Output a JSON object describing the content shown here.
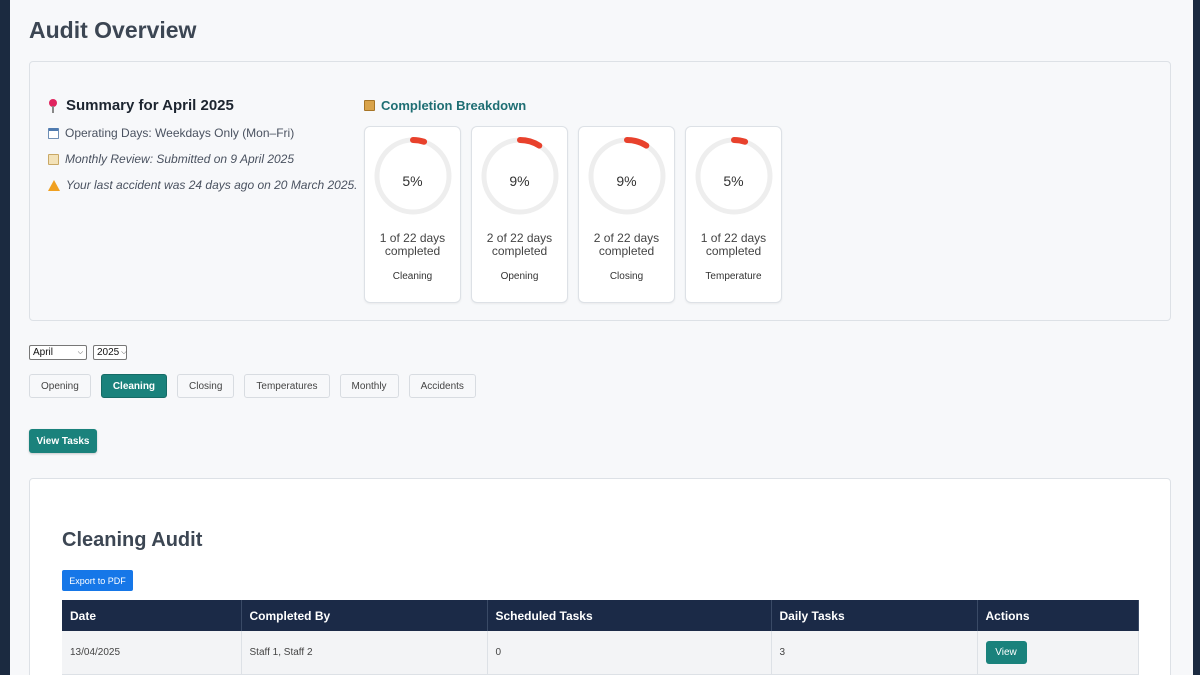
{
  "page": {
    "title": "Audit Overview"
  },
  "summary": {
    "heading": "Summary for April 2025",
    "operating_days": "Operating Days: Weekdays Only (Mon–Fri)",
    "monthly_review": "Monthly Review: Submitted on 9 April 2025",
    "last_accident": "Your last accident was 24 days ago on 20 March 2025."
  },
  "breakdown": {
    "heading": "Completion Breakdown",
    "gauges": [
      {
        "percent_label": "5%",
        "percent": 5,
        "days": "1 of 22 days completed",
        "label": "Cleaning"
      },
      {
        "percent_label": "9%",
        "percent": 9,
        "days": "2 of 22 days completed",
        "label": "Opening"
      },
      {
        "percent_label": "9%",
        "percent": 9,
        "days": "2 of 22 days completed",
        "label": "Closing"
      },
      {
        "percent_label": "5%",
        "percent": 5,
        "days": "1 of 22 days completed",
        "label": "Temperature"
      }
    ],
    "colors": {
      "progress": "#e8412c",
      "track": "#eeeeee"
    }
  },
  "filters": {
    "month": "April",
    "year": "2025"
  },
  "tabs": [
    {
      "label": "Opening",
      "active": false
    },
    {
      "label": "Cleaning",
      "active": true
    },
    {
      "label": "Closing",
      "active": false
    },
    {
      "label": "Temperatures",
      "active": false
    },
    {
      "label": "Monthly",
      "active": false
    },
    {
      "label": "Accidents",
      "active": false
    }
  ],
  "view_tasks_label": "View Tasks",
  "audit": {
    "title": "Cleaning Audit",
    "export_label": "Export to PDF",
    "columns": [
      "Date",
      "Completed By",
      "Scheduled Tasks",
      "Daily Tasks",
      "Actions"
    ],
    "rows": [
      {
        "date": "13/04/2025",
        "completed_by": "Staff 1, Staff 2",
        "scheduled": "0",
        "daily": "3",
        "action": "View"
      }
    ]
  },
  "theme": {
    "accent": "#1a827c",
    "header_bg": "#1b2a47",
    "export_blue": "#1677e8"
  }
}
